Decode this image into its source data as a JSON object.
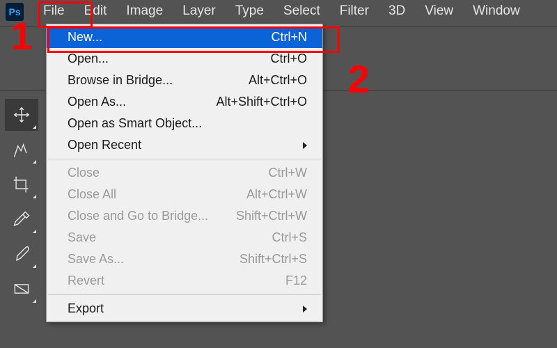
{
  "app": {
    "icon_text": "Ps"
  },
  "menubar": {
    "items": [
      "File",
      "Edit",
      "Image",
      "Layer",
      "Type",
      "Select",
      "Filter",
      "3D",
      "View",
      "Window"
    ]
  },
  "file_menu": {
    "groups": [
      [
        {
          "label": "New...",
          "shortcut": "Ctrl+N",
          "enabled": true,
          "highlight": true
        },
        {
          "label": "Open...",
          "shortcut": "Ctrl+O",
          "enabled": true
        },
        {
          "label": "Browse in Bridge...",
          "shortcut": "Alt+Ctrl+O",
          "enabled": true
        },
        {
          "label": "Open As...",
          "shortcut": "Alt+Shift+Ctrl+O",
          "enabled": true
        },
        {
          "label": "Open as Smart Object...",
          "shortcut": "",
          "enabled": true
        },
        {
          "label": "Open Recent",
          "shortcut": "",
          "enabled": true,
          "submenu": true
        }
      ],
      [
        {
          "label": "Close",
          "shortcut": "Ctrl+W",
          "enabled": false
        },
        {
          "label": "Close All",
          "shortcut": "Alt+Ctrl+W",
          "enabled": false
        },
        {
          "label": "Close and Go to Bridge...",
          "shortcut": "Shift+Ctrl+W",
          "enabled": false
        },
        {
          "label": "Save",
          "shortcut": "Ctrl+S",
          "enabled": false
        },
        {
          "label": "Save As...",
          "shortcut": "Shift+Ctrl+S",
          "enabled": false
        },
        {
          "label": "Revert",
          "shortcut": "F12",
          "enabled": false
        }
      ],
      [
        {
          "label": "Export",
          "shortcut": "",
          "enabled": true,
          "submenu": true
        }
      ]
    ]
  },
  "annotations": {
    "one": "1",
    "two": "2"
  }
}
